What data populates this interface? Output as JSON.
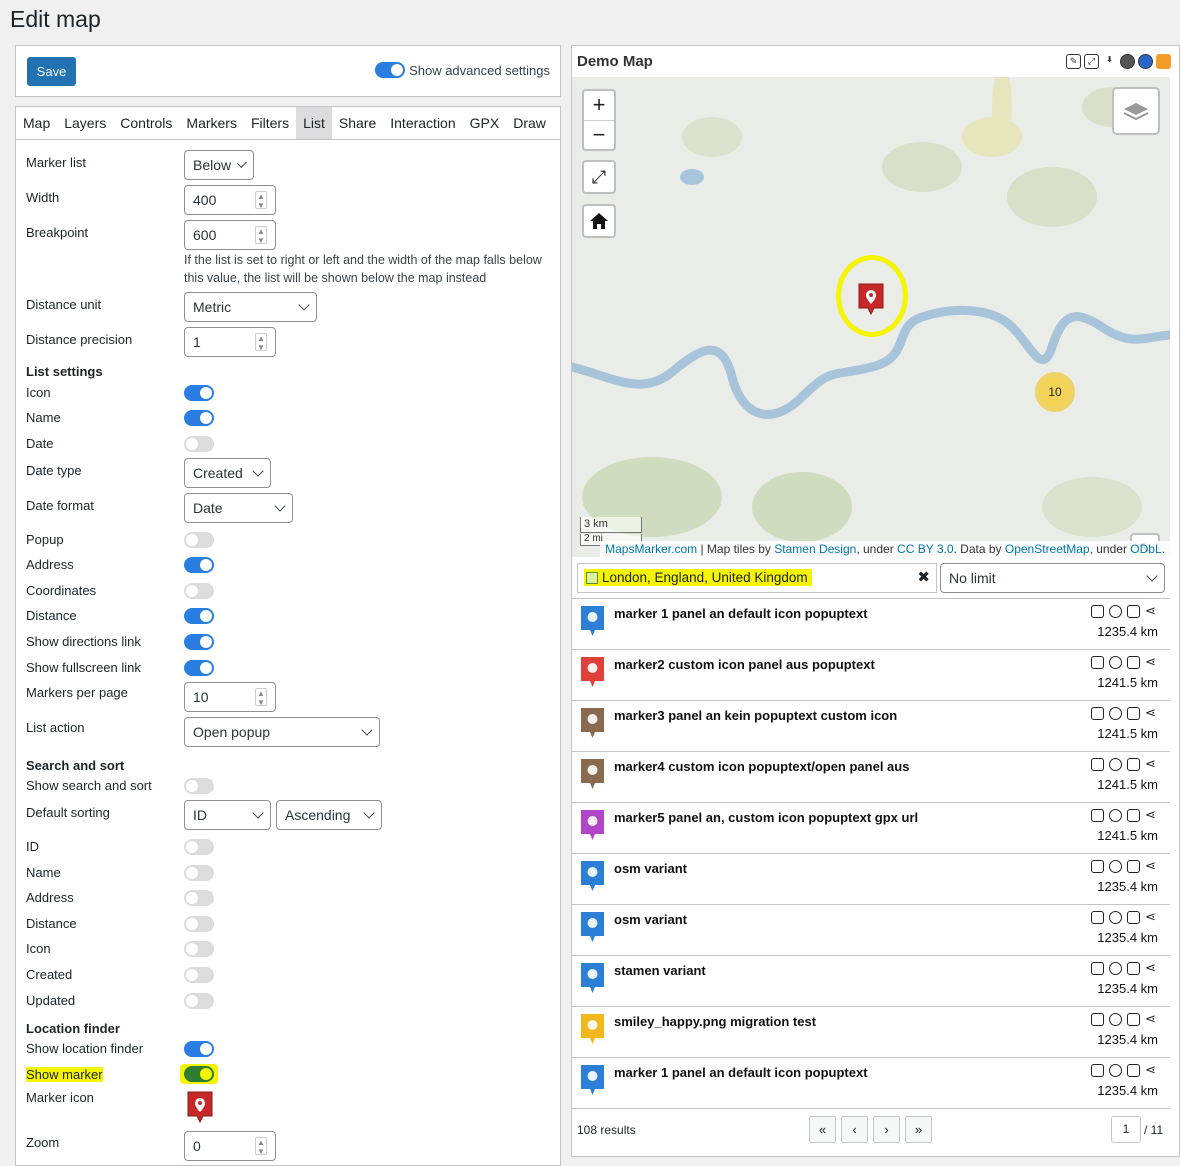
{
  "page": {
    "title": "Edit map"
  },
  "toolbar": {
    "save_label": "Save",
    "advanced_label": "Show advanced settings"
  },
  "tabs": [
    "Map",
    "Layers",
    "Controls",
    "Markers",
    "Filters",
    "List",
    "Share",
    "Interaction",
    "GPX",
    "Draw"
  ],
  "active_tab": "List",
  "settings": {
    "marker_list": {
      "label": "Marker list",
      "value": "Below"
    },
    "width": {
      "label": "Width",
      "value": "400"
    },
    "breakpoint": {
      "label": "Breakpoint",
      "value": "600",
      "help": "If the list is set to right or left and the width of the map falls below this value, the list will be shown below the map instead"
    },
    "distance_unit": {
      "label": "Distance unit",
      "value": "Metric"
    },
    "distance_precision": {
      "label": "Distance precision",
      "value": "1"
    },
    "list_settings_heading": "List settings",
    "icon": {
      "label": "Icon",
      "on": true
    },
    "name": {
      "label": "Name",
      "on": true
    },
    "date": {
      "label": "Date",
      "on": false
    },
    "date_type": {
      "label": "Date type",
      "value": "Created"
    },
    "date_format": {
      "label": "Date format",
      "value": "Date"
    },
    "popup": {
      "label": "Popup",
      "on": false
    },
    "address": {
      "label": "Address",
      "on": true
    },
    "coordinates": {
      "label": "Coordinates",
      "on": false
    },
    "distance": {
      "label": "Distance",
      "on": true
    },
    "directions": {
      "label": "Show directions link",
      "on": true
    },
    "fullscreen": {
      "label": "Show fullscreen link",
      "on": true
    },
    "per_page": {
      "label": "Markers per page",
      "value": "10"
    },
    "list_action": {
      "label": "List action",
      "value": "Open popup"
    },
    "search_heading": "Search and sort",
    "show_search": {
      "label": "Show search and sort",
      "on": false
    },
    "default_sorting": {
      "label": "Default sorting",
      "field": "ID",
      "order": "Ascending"
    },
    "sort_id": {
      "label": "ID",
      "on": false
    },
    "sort_name": {
      "label": "Name",
      "on": false
    },
    "sort_address": {
      "label": "Address",
      "on": false
    },
    "sort_distance": {
      "label": "Distance",
      "on": false
    },
    "sort_icon": {
      "label": "Icon",
      "on": false
    },
    "sort_created": {
      "label": "Created",
      "on": false
    },
    "sort_updated": {
      "label": "Updated",
      "on": false
    },
    "location_heading": "Location finder",
    "show_location": {
      "label": "Show location finder",
      "on": true
    },
    "show_marker": {
      "label": "Show marker",
      "on": true
    },
    "marker_icon": {
      "label": "Marker icon"
    },
    "zoom": {
      "label": "Zoom",
      "value": "0"
    }
  },
  "map": {
    "title": "Demo Map",
    "zoom_in": "+",
    "zoom_out": "−",
    "scale_km": "3 km",
    "scale_mi": "2 mi",
    "cluster_count": "10",
    "attribution": {
      "a1": "MapsMarker.com",
      "t1": " | Map tiles by ",
      "a2": "Stamen Design",
      "t2": ", under ",
      "a3": "CC BY 3.0",
      "t3": ". Data by ",
      "a4": "OpenStreetMap",
      "t4": ", under ",
      "a5": "ODbL",
      "t5": "."
    }
  },
  "filter": {
    "location": "London, England, United Kingdom",
    "limit": "No limit"
  },
  "markers": [
    {
      "name": "marker 1 panel an default icon popuptext",
      "distance": "1235.4 km",
      "icon": "pin-icon",
      "color": "#2c7fd6"
    },
    {
      "name": "marker2 custom icon panel aus popuptext",
      "distance": "1241.5 km",
      "icon": "wheelchair-icon",
      "color": "#e0403a"
    },
    {
      "name": "marker3 panel an kein popuptext custom icon",
      "distance": "1241.5 km",
      "icon": "airplane-icon",
      "color": "#8a6a4f"
    },
    {
      "name": "marker4 custom icon popuptext/open panel aus",
      "distance": "1241.5 km",
      "icon": "stop-sign-icon",
      "color": "#8a6a4f"
    },
    {
      "name": "marker5 panel an, custom icon popuptext gpx url",
      "distance": "1241.5 km",
      "icon": "lake-icon",
      "color": "#b045c8"
    },
    {
      "name": "osm variant",
      "distance": "1235.4 km",
      "icon": "pin-icon",
      "color": "#2c7fd6"
    },
    {
      "name": "osm variant",
      "distance": "1235.4 km",
      "icon": "pin-icon",
      "color": "#2c7fd6"
    },
    {
      "name": "stamen variant",
      "distance": "1235.4 km",
      "icon": "pin-icon",
      "color": "#2c7fd6"
    },
    {
      "name": "smiley_happy.png migration test",
      "distance": "1235.4 km",
      "icon": "smiley-icon",
      "color": "#f2b71a"
    },
    {
      "name": "marker 1 panel an default icon popuptext",
      "distance": "1235.4 km",
      "icon": "pin-icon",
      "color": "#2c7fd6"
    }
  ],
  "pagination": {
    "results": "108 results",
    "first": "«",
    "prev": "‹",
    "next": "›",
    "last": "»",
    "current": "1",
    "total": "/ 11"
  }
}
